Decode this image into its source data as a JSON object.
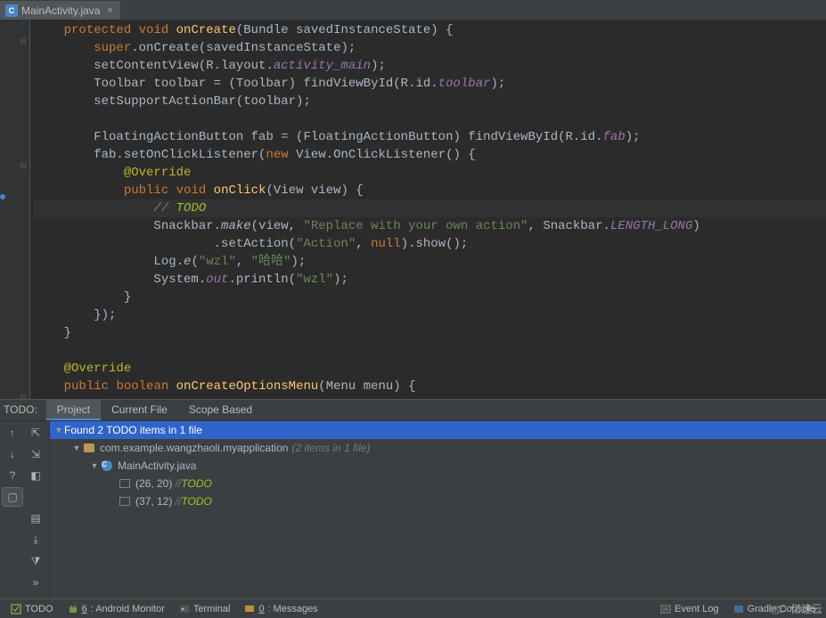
{
  "tab": {
    "file_name": "MainActivity.java",
    "icon_letter": "C",
    "close_char": "×"
  },
  "code": {
    "l1_kw1": "protected",
    "l1_kw2": "void",
    "l1_fn": "onCreate",
    "l1_txt1": "(Bundle savedInstanceState) {",
    "l2_kw": "super",
    "l2_txt": ".onCreate(savedInstanceState);",
    "l3_txt1": "setContentView(R.layout.",
    "l3_field": "activity_main",
    "l3_txt2": ");",
    "l4_txt1": "Toolbar toolbar = (Toolbar) findViewById(R.id.",
    "l4_field": "toolbar",
    "l4_txt2": ");",
    "l5_txt": "setSupportActionBar(toolbar);",
    "l7_txt1": "FloatingActionButton fab = (FloatingActionButton) findViewById(R.id.",
    "l7_field": "fab",
    "l7_txt2": ");",
    "l8_txt1": "fab.setOnClickListener(",
    "l8_kw": "new",
    "l8_txt2": " View.OnClickListener() {",
    "l9_ann": "@Override",
    "l10_kw1": "public",
    "l10_kw2": "void",
    "l10_fn": "onClick",
    "l10_txt": "(View view) {",
    "l11_cmt": "// ",
    "l11_todo": "TODO",
    "l12_txt1": "Snackbar.",
    "l12_m": "make",
    "l12_txt2": "(view, ",
    "l12_str": "\"Replace with your own action\"",
    "l12_txt3": ", Snackbar.",
    "l12_field": "LENGTH_LONG",
    "l12_txt4": ")",
    "l13_txt1": ".setAction(",
    "l13_str": "\"Action\"",
    "l13_txt2": ", ",
    "l13_kw": "null",
    "l13_txt3": ").show();",
    "l14_txt1": "Log.",
    "l14_m": "e",
    "l14_txt2": "(",
    "l14_str1": "\"wzl\"",
    "l14_txt3": ", ",
    "l14_str2": "\"哈哈\"",
    "l14_txt4": ");",
    "l15_txt1": "System.",
    "l15_field": "out",
    "l15_txt2": ".println(",
    "l15_str": "\"wzl\"",
    "l15_txt3": ");",
    "l16_txt": "}",
    "l17_txt": "});",
    "l18_txt": "}",
    "l20_ann": "@Override",
    "l21_kw1": "public",
    "l21_kw2": "boolean",
    "l21_fn": "onCreateOptionsMenu",
    "l21_txt": "(Menu menu) {"
  },
  "todo": {
    "label": "TODO:",
    "tabs": {
      "project": "Project",
      "current_file": "Current File",
      "scope_based": "Scope Based"
    },
    "found": "Found 2 TODO items in 1 file",
    "pkg": "com.example.wangzhaoli.myapplication",
    "pkg_hint": "(2 items in 1 file)",
    "class_letter": "C",
    "class_name": "MainActivity.java",
    "item1_loc": "(26, 20)",
    "item1_cmt": "// ",
    "item1_kw": "TODO",
    "item2_loc": "(37, 12)",
    "item2_cmt": "// ",
    "item2_kw": "TODO"
  },
  "side_icons": {
    "up": "↑",
    "down": "↓",
    "expand": "⇱",
    "collapse": "⇲",
    "help": "?",
    "scroll": "◧",
    "group": "▢",
    "flat": "▤",
    "export": "⤓",
    "filter": "⧩",
    "more": "»"
  },
  "status": {
    "todo": "TODO",
    "android_key": "6",
    "android": ": Android Monitor",
    "terminal": "Terminal",
    "messages_key": "0",
    "messages": ": Messages",
    "event_log": "Event Log",
    "gradle": "Gradle Console"
  },
  "watermark": "亿速云"
}
